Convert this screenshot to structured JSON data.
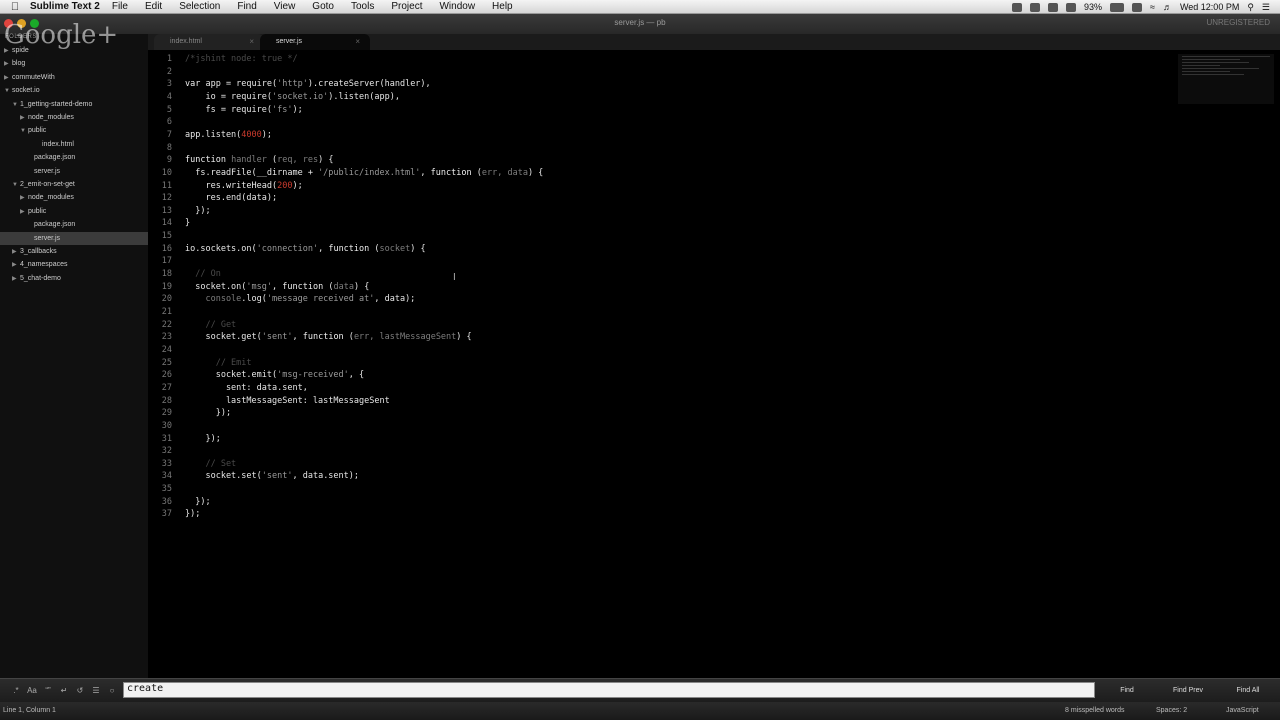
{
  "menubar": {
    "app_name": "Sublime Text 2",
    "items": [
      "File",
      "Edit",
      "Selection",
      "Find",
      "View",
      "Goto",
      "Tools",
      "Project",
      "Window",
      "Help"
    ],
    "battery": "93%",
    "clock": "Wed 12:00 PM"
  },
  "window": {
    "title": "server.js — pb",
    "unregistered": "UNREGISTERED"
  },
  "overlay_logo": "Google+",
  "tabs": [
    {
      "label": "index.html",
      "active": false
    },
    {
      "label": "server.js",
      "active": true
    }
  ],
  "sidebar": {
    "header": "FOLDERS",
    "items": [
      {
        "label": "spide",
        "depth": 0,
        "expanded": false,
        "folder": true,
        "selected": false
      },
      {
        "label": "blog",
        "depth": 0,
        "expanded": false,
        "folder": true,
        "selected": false
      },
      {
        "label": "commuteWith",
        "depth": 0,
        "expanded": false,
        "folder": true,
        "selected": false
      },
      {
        "label": "socket.io",
        "depth": 0,
        "expanded": true,
        "folder": true,
        "selected": false
      },
      {
        "label": "1_getting-started-demo",
        "depth": 1,
        "expanded": true,
        "folder": true,
        "selected": false
      },
      {
        "label": "node_modules",
        "depth": 2,
        "expanded": false,
        "folder": true,
        "selected": false
      },
      {
        "label": "public",
        "depth": 2,
        "expanded": true,
        "folder": true,
        "selected": false
      },
      {
        "label": "index.html",
        "depth": 3,
        "expanded": false,
        "folder": false,
        "selected": false
      },
      {
        "label": "package.json",
        "depth": 2,
        "expanded": false,
        "folder": false,
        "selected": false
      },
      {
        "label": "server.js",
        "depth": 2,
        "expanded": false,
        "folder": false,
        "selected": false
      },
      {
        "label": "2_emit-on-set-get",
        "depth": 1,
        "expanded": true,
        "folder": true,
        "selected": false
      },
      {
        "label": "node_modules",
        "depth": 2,
        "expanded": false,
        "folder": true,
        "selected": false
      },
      {
        "label": "public",
        "depth": 2,
        "expanded": false,
        "folder": true,
        "selected": false
      },
      {
        "label": "package.json",
        "depth": 2,
        "expanded": false,
        "folder": false,
        "selected": false
      },
      {
        "label": "server.js",
        "depth": 2,
        "expanded": false,
        "folder": false,
        "selected": true
      },
      {
        "label": "3_callbacks",
        "depth": 1,
        "expanded": false,
        "folder": true,
        "selected": false
      },
      {
        "label": "4_namespaces",
        "depth": 1,
        "expanded": false,
        "folder": true,
        "selected": false
      },
      {
        "label": "5_chat-demo",
        "depth": 1,
        "expanded": false,
        "folder": true,
        "selected": false
      }
    ]
  },
  "code_lines": [
    [
      [
        "com",
        "/*jshint node: true */"
      ]
    ],
    [],
    [
      [
        "kw",
        "var"
      ],
      [
        "t",
        " app = require("
      ],
      [
        "str",
        "'http'"
      ],
      [
        "t",
        ").createServer(handler),"
      ]
    ],
    [
      [
        "t",
        "    io = require("
      ],
      [
        "str",
        "'socket.io'"
      ],
      [
        "t",
        ").listen(app),"
      ]
    ],
    [
      [
        "t",
        "    fs = require("
      ],
      [
        "str",
        "'fs'"
      ],
      [
        "t",
        ");"
      ]
    ],
    [],
    [
      [
        "t",
        "app.listen("
      ],
      [
        "num",
        "4000"
      ],
      [
        "t",
        ");"
      ]
    ],
    [],
    [
      [
        "kw",
        "function"
      ],
      [
        "dim",
        " handler "
      ],
      [
        "t",
        "("
      ],
      [
        "dim",
        "req, res"
      ],
      [
        "t",
        ") {"
      ]
    ],
    [
      [
        "t",
        "  fs.readFile(__dirname + "
      ],
      [
        "str",
        "'/public/index.html'"
      ],
      [
        "t",
        ", "
      ],
      [
        "kw",
        "function"
      ],
      [
        "t",
        " ("
      ],
      [
        "dim",
        "err, data"
      ],
      [
        "t",
        ") {"
      ]
    ],
    [
      [
        "t",
        "    res.writeHead("
      ],
      [
        "num",
        "200"
      ],
      [
        "t",
        ");"
      ]
    ],
    [
      [
        "t",
        "    res.end(data);"
      ]
    ],
    [
      [
        "t",
        "  });"
      ]
    ],
    [
      [
        "t",
        "}"
      ]
    ],
    [],
    [
      [
        "t",
        "io.sockets.on("
      ],
      [
        "str",
        "'connection'"
      ],
      [
        "t",
        ", "
      ],
      [
        "kw",
        "function"
      ],
      [
        "t",
        " ("
      ],
      [
        "dim",
        "socket"
      ],
      [
        "t",
        ") {"
      ]
    ],
    [],
    [
      [
        "com",
        "  // On"
      ]
    ],
    [
      [
        "t",
        "  socket.on("
      ],
      [
        "str",
        "'msg'"
      ],
      [
        "t",
        ", "
      ],
      [
        "kw",
        "function"
      ],
      [
        "t",
        " ("
      ],
      [
        "dim",
        "data"
      ],
      [
        "t",
        ") {"
      ]
    ],
    [
      [
        "dim",
        "    console"
      ],
      [
        "t",
        ".log("
      ],
      [
        "str",
        "'message received at'"
      ],
      [
        "t",
        ", data);"
      ]
    ],
    [],
    [
      [
        "com",
        "    // Get"
      ]
    ],
    [
      [
        "t",
        "    socket.get("
      ],
      [
        "str",
        "'sent'"
      ],
      [
        "t",
        ", "
      ],
      [
        "kw",
        "function"
      ],
      [
        "t",
        " ("
      ],
      [
        "dim",
        "err, lastMessageSent"
      ],
      [
        "t",
        ") {"
      ]
    ],
    [],
    [
      [
        "com",
        "      // Emit"
      ]
    ],
    [
      [
        "t",
        "      socket.emit("
      ],
      [
        "str",
        "'msg-received'"
      ],
      [
        "t",
        ", {"
      ]
    ],
    [
      [
        "t",
        "        sent: data.sent,"
      ]
    ],
    [
      [
        "t",
        "        lastMessageSent: lastMessageSent"
      ]
    ],
    [
      [
        "t",
        "      });"
      ]
    ],
    [],
    [
      [
        "t",
        "    });"
      ]
    ],
    [],
    [
      [
        "com",
        "    // Set"
      ]
    ],
    [
      [
        "t",
        "    socket.set("
      ],
      [
        "str",
        "'sent'"
      ],
      [
        "t",
        ", data.sent);"
      ]
    ],
    [],
    [
      [
        "t",
        "  });"
      ]
    ],
    [
      [
        "t",
        "});"
      ]
    ]
  ],
  "findbar": {
    "query": "create",
    "find_label": "Find",
    "find_prev_label": "Find Prev",
    "find_all_label": "Find All",
    "options": [
      "regex",
      "case",
      "whole-word",
      "wrap",
      "in-selection",
      "highlight"
    ]
  },
  "status": {
    "position": "Line 1, Column 1",
    "spelling": "8 misspelled words",
    "spaces": "Spaces: 2",
    "syntax": "JavaScript"
  }
}
